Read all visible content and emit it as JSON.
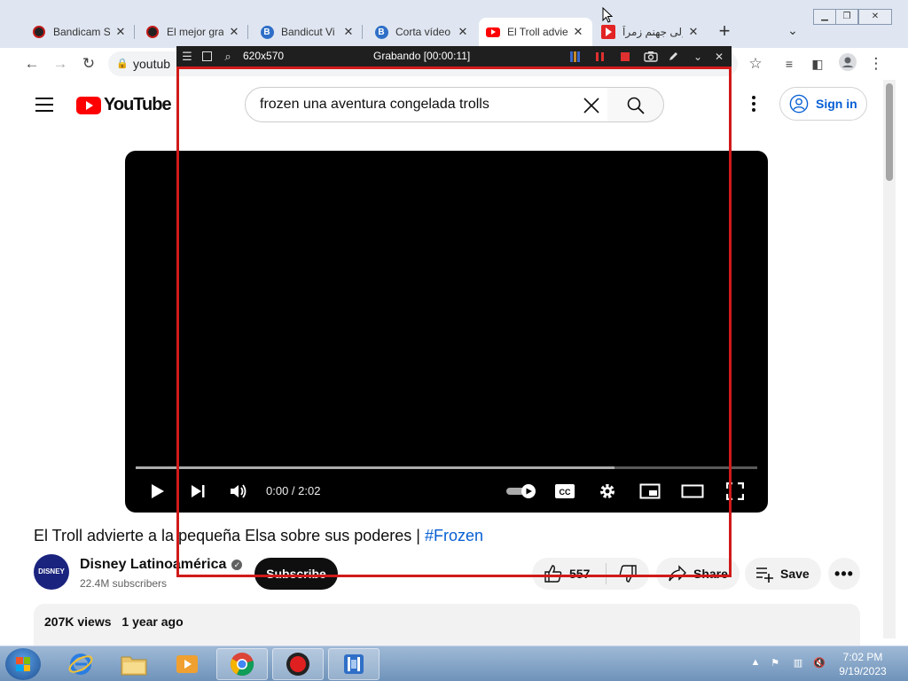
{
  "browser": {
    "tabs": [
      {
        "title": "Bandicam S",
        "icon": "bandicam-record-icon",
        "active": false
      },
      {
        "title": "El mejor gra",
        "icon": "bandicam-record-icon",
        "active": false
      },
      {
        "title": "Bandicut Vi",
        "icon": "bandicut-icon",
        "active": false
      },
      {
        "title": "Corta vídeo",
        "icon": "bandicut-icon",
        "active": false
      },
      {
        "title": "El Troll advie",
        "icon": "youtube-icon",
        "active": true
      },
      {
        "title": "إلى جهنم زمراً",
        "icon": "red-play-icon",
        "active": false
      }
    ],
    "address": "youtub",
    "new_tab_label": "+",
    "window_buttons": [
      "minimize",
      "restore",
      "close"
    ]
  },
  "bandicam": {
    "size": "620x570",
    "status": "Grabando [00:00:11]"
  },
  "youtube": {
    "logo_text": "YouTube",
    "search_query": "frozen una aventura congelada trolls",
    "signin_label": "Sign in",
    "player": {
      "time": "0:00 / 2:02",
      "progress_fraction": 0.0,
      "buffered_fraction": 0.77
    },
    "video": {
      "title": "El Troll advierte a la pequeña Elsa sobre sus poderes |",
      "hashtag": "#Frozen"
    },
    "channel": {
      "name": "Disney Latinoamérica",
      "subscribers": "22.4M subscribers",
      "avatar_text": "DISNEY"
    },
    "subscribe_label": "Subscribe",
    "actions": {
      "likes": "557",
      "share": "Share",
      "save": "Save"
    },
    "description": {
      "views": "207K views",
      "age": "1 year ago"
    }
  },
  "taskbar": {
    "time": "7:02 PM",
    "date": "9/19/2023"
  },
  "colors": {
    "youtube_red": "#ff0000",
    "link_blue": "#065fd4",
    "recording_red": "#d11a1a",
    "taskbar_blue": "#6f93ba"
  }
}
